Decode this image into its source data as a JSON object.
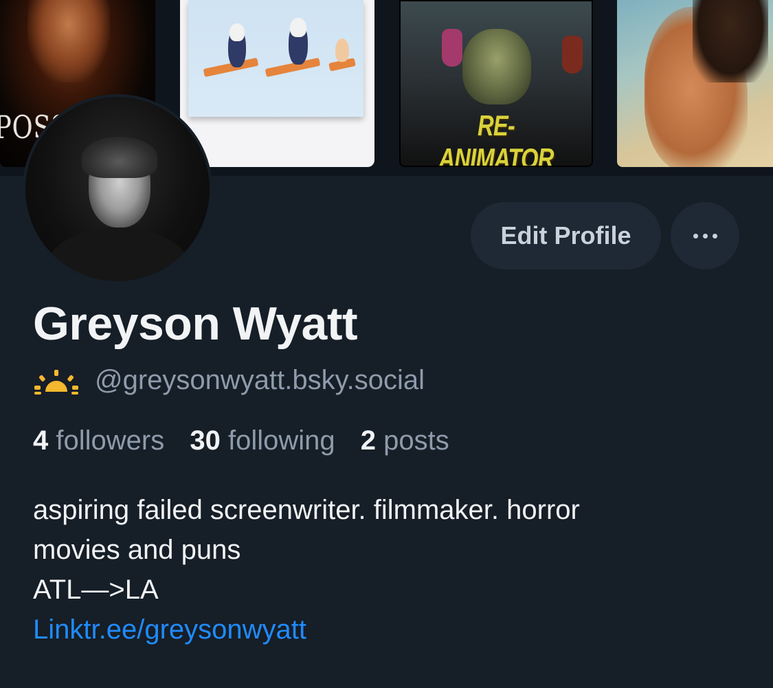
{
  "banner": {
    "posters": [
      {
        "title": "POSSES"
      },
      {
        "title": ""
      },
      {
        "title": "RE-ANIMATOR"
      },
      {
        "title": ""
      }
    ]
  },
  "profile": {
    "display_name": "Greyson Wyatt",
    "handle": "@greysonwyatt.bsky.social",
    "handle_icon": "sunrise-icon",
    "stats": {
      "followers_count": "4",
      "followers_label": "followers",
      "following_count": "30",
      "following_label": "following",
      "posts_count": "2",
      "posts_label": "posts"
    },
    "bio": {
      "line1": "aspiring failed screenwriter. filmmaker. horror",
      "line2": "movies and puns",
      "line3": "ATL—>LA",
      "link": "Linktr.ee/greysonwyatt"
    }
  },
  "actions": {
    "edit_profile_label": "Edit Profile",
    "more_icon": "ellipsis-icon"
  },
  "colors": {
    "background": "#161e27",
    "button_bg": "#1e2935",
    "muted_text": "#8e9bab",
    "link": "#208bfe",
    "sun_icon": "#f5b82e"
  }
}
